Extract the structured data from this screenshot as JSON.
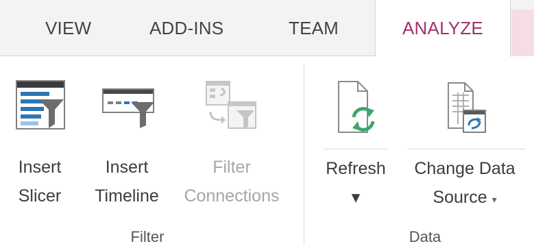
{
  "tabs": [
    {
      "label": "VIEW"
    },
    {
      "label": "ADD-INS"
    },
    {
      "label": "TEAM"
    },
    {
      "label": "ANALYZE",
      "active": true
    }
  ],
  "groups": {
    "filter": {
      "label": "Filter",
      "buttons": {
        "insert_slicer": {
          "line1": "Insert",
          "line2": "Slicer",
          "icon": "slicer-icon"
        },
        "insert_timeline": {
          "line1": "Insert",
          "line2": "Timeline",
          "icon": "timeline-icon"
        },
        "filter_connections": {
          "line1": "Filter",
          "line2": "Connections",
          "icon": "filter-connections-icon",
          "disabled": true
        }
      }
    },
    "data": {
      "label": "Data",
      "buttons": {
        "refresh": {
          "line1": "Refresh",
          "caret": "▾",
          "icon": "refresh-icon"
        },
        "change_data_source": {
          "line1": "Change Data",
          "line2": "Source",
          "caret": "▾",
          "icon": "change-data-source-icon"
        }
      }
    }
  },
  "colors": {
    "accent": "#a4306d",
    "tab_bg": "#f3f3f3",
    "contextual_tab": "#f5dce7",
    "slicer_blue": "#2e75b6",
    "refresh_green": "#3fa56b"
  }
}
